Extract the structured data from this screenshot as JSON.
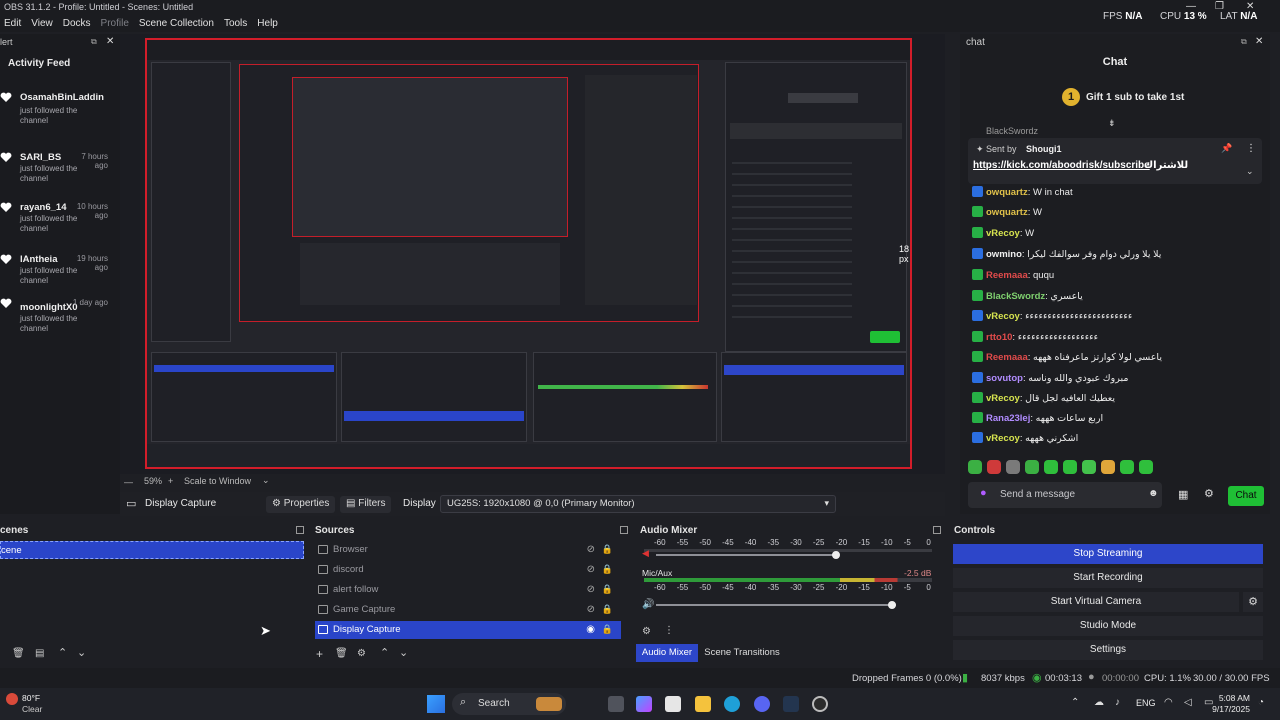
{
  "titlebar": {
    "title": "OBS 31.1.2 - Profile: Untitled - Scenes: Untitled"
  },
  "menu": [
    "Edit",
    "View",
    "Docks",
    "Profile",
    "Scene Collection",
    "Tools",
    "Help"
  ],
  "stats": {
    "fps_label": "FPS",
    "fps": "N/A",
    "cpu_label": "CPU",
    "cpu": "13 %",
    "lat_label": "LAT",
    "lat": "N/A"
  },
  "alert_dock": {
    "header": "lert",
    "title": "Activity Feed",
    "items": [
      {
        "name": "OsamahBinLaddin",
        "ago": "",
        "msg": "just followed the channel"
      },
      {
        "name": "SARI_BS",
        "ago": "7 hours ago",
        "msg": "just followed the channel"
      },
      {
        "name": "rayan6_14",
        "ago": "10 hours ago",
        "msg": "just followed the channel"
      },
      {
        "name": "lAntheia",
        "ago": "19 hours ago",
        "msg": "just followed the channel"
      },
      {
        "name": "moonlightX0",
        "ago": "1 day ago",
        "msg": "just followed the channel"
      }
    ]
  },
  "preview": {
    "zoom": "59%",
    "scale_mode": "Scale to Window",
    "px_label": "18 px"
  },
  "source_bar": {
    "source": "Display Capture",
    "properties": "Properties",
    "filters": "Filters",
    "display_label": "Display",
    "display_value": "UG25S: 1920x1080 @ 0,0 (Primary Monitor)"
  },
  "chat": {
    "header": "chat",
    "title": "Chat",
    "pinned": "Gift 1 sub to take 1st",
    "sent_by_label": "Sent by",
    "sent_by_user": "Shougi1",
    "link_text": "https://kick.com/aboodrisk/subscribe",
    "link_suffix": "للاشتراك",
    "top_cut": "BlackSwordz",
    "messages": [
      {
        "user": "owquartz",
        "text": "W in chat",
        "color": "#e0c14a"
      },
      {
        "user": "owquartz",
        "text": "W",
        "color": "#e0c14a"
      },
      {
        "user": "vRecoy",
        "text": "W",
        "color": "#d6e34f"
      },
      {
        "user": "owmino",
        "text": "يلا يلا ورلي دوام وفر سوالفك ليكرا",
        "color": "#f0f0f0"
      },
      {
        "user": "Reemaaa",
        "text": "ququ",
        "color": "#e14b4b"
      },
      {
        "user": "BlackSwordz",
        "text": "ياعسري",
        "color": "#7fd06f"
      },
      {
        "user": "vRecoy",
        "text": "ءءءءءءءءءءءءءءءءءءءءءءءء",
        "color": "#d6e34f"
      },
      {
        "user": "rtto10",
        "text": "ءءءءءءءءءءءءءءءءءء",
        "color": "#e14b4b"
      },
      {
        "user": "Reemaaa",
        "text": "ياعسي لولا كوارتز ماعرفناه هههه",
        "color": "#e14b4b"
      },
      {
        "user": "sovutop",
        "text": "مبروك عبودي والله وناسه",
        "color": "#b18cff"
      },
      {
        "user": "vRecoy",
        "text": "يعطيك العافيه لجل قال",
        "color": "#d6e34f"
      },
      {
        "user": "Rana23lej",
        "text": "اربع ساعات هههه",
        "color": "#b18cff"
      },
      {
        "user": "vRecoy",
        "text": "اشكرني هههه",
        "color": "#d6e34f"
      }
    ],
    "send_placeholder": "Send a message",
    "chat_button": "Chat"
  },
  "scenes": {
    "header": "cenes",
    "items": [
      "cene"
    ]
  },
  "sources": {
    "header": "Sources",
    "items": [
      {
        "name": "Browser",
        "selected": false
      },
      {
        "name": "discord",
        "selected": false
      },
      {
        "name": "alert follow",
        "selected": false
      },
      {
        "name": "Game Capture",
        "selected": false
      },
      {
        "name": "Display Capture",
        "selected": true
      }
    ]
  },
  "mixer": {
    "header": "Audio Mixer",
    "ticks": [
      "-60",
      "-55",
      "-50",
      "-45",
      "-40",
      "-35",
      "-30",
      "-25",
      "-20",
      "-15",
      "-10",
      "-5",
      "0"
    ],
    "channel2_name": "Mic/Aux",
    "channel2_db": "-2.5 dB",
    "tab_active": "Audio Mixer",
    "tab_other": "Scene Transitions"
  },
  "controls": {
    "header": "Controls",
    "buttons": [
      "Stop Streaming",
      "Start Recording",
      "Start Virtual Camera",
      "Studio Mode",
      "Settings"
    ]
  },
  "status": {
    "dropped": "Dropped Frames 0 (0.0%)",
    "kbps": "8037 kbps",
    "stream_time": "00:03:13",
    "rec_time": "00:00:00",
    "cpu": "CPU: 1.1%",
    "fps": "30.00 / 30.00 FPS"
  },
  "taskbar": {
    "weather_temp": "80°F",
    "weather_desc": "Clear",
    "search": "Search",
    "lang": "ENG",
    "time": "5:08 AM",
    "date": "9/17/2025"
  },
  "colors": {
    "accent": "#2d46c9",
    "record_border": "#d31d2a",
    "kick_green": "#1fbf35"
  }
}
